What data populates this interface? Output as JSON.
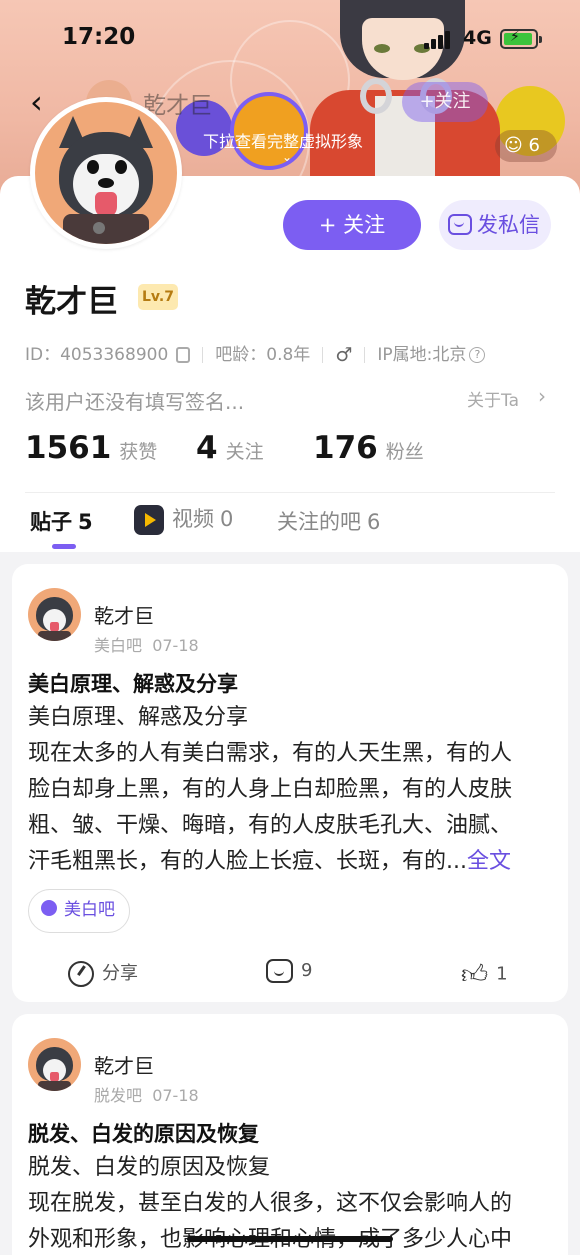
{
  "status_bar": {
    "time": "17:20",
    "network": "4G"
  },
  "header": {
    "mini_name": "乾才巨",
    "mini_follow": "+关注",
    "pull_hint": "下拉查看完整虚拟形象",
    "like_count": "6"
  },
  "profile": {
    "follow_button": "+ 关注",
    "dm_button": "发私信",
    "username": "乾才巨",
    "level": "Lv.7",
    "id_text": "ID：4053368900",
    "tieba_age": "吧龄：0.8年",
    "gender_symbol": "♂",
    "ip_location": "IP属地:北京",
    "signature": "该用户还没有填写签名...",
    "about": "关于Ta",
    "stats": [
      {
        "num": "1561",
        "label": "获赞"
      },
      {
        "num": "4",
        "label": "关注"
      },
      {
        "num": "176",
        "label": "粉丝"
      }
    ],
    "tabs": [
      {
        "label": "贴子",
        "count": "5"
      },
      {
        "label": "视频",
        "count": "0"
      },
      {
        "label": "关注的吧",
        "count": "6"
      }
    ]
  },
  "posts": [
    {
      "author": "乾才巨",
      "forum": "美白吧",
      "date": "07-18",
      "title": "美白原理、解惑及分享",
      "body_lines": [
        "美白原理、解惑及分享",
        "现在太多的人有美白需求，有的人天生黑，有的人",
        "脸白却身上黑，有的人身上白却脸黑，有的人皮肤",
        "粗、皱、干燥、晦暗，有的人皮肤毛孔大、油腻、",
        "汗毛粗黑长，有的人脸上长痘、长斑，有的..."
      ],
      "more": "全文",
      "tag": "美白吧",
      "share": "分享",
      "comments": "9",
      "likes": "1"
    },
    {
      "author": "乾才巨",
      "forum": "脱发吧",
      "date": "07-18",
      "title": "脱发、白发的原因及恢复",
      "body_lines": [
        "脱发、白发的原因及恢复",
        "现在脱发，甚至白发的人很多，这不仅会影响人的",
        "外观和形象，也影响心理和心情，成了多少人心中"
      ]
    }
  ],
  "colors": {
    "accent": "#7c5ef2",
    "banner": "#f0b8a4",
    "level_bg": "#fde9b0"
  }
}
